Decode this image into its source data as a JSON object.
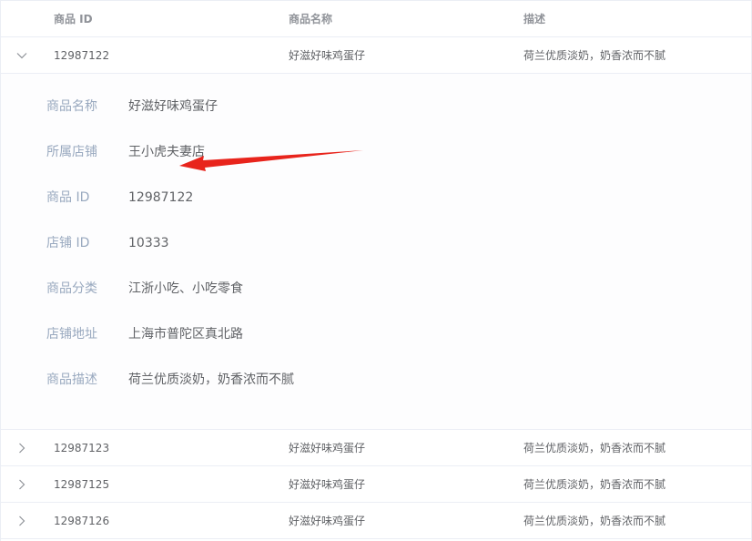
{
  "table": {
    "columns": [
      "商品 ID",
      "商品名称",
      "描述"
    ],
    "rows": [
      {
        "id": "12987122",
        "name": "好滋好味鸡蛋仔",
        "desc": "荷兰优质淡奶，奶香浓而不腻",
        "expanded": true
      },
      {
        "id": "12987123",
        "name": "好滋好味鸡蛋仔",
        "desc": "荷兰优质淡奶，奶香浓而不腻",
        "expanded": false
      },
      {
        "id": "12987125",
        "name": "好滋好味鸡蛋仔",
        "desc": "荷兰优质淡奶，奶香浓而不腻",
        "expanded": false
      },
      {
        "id": "12987126",
        "name": "好滋好味鸡蛋仔",
        "desc": "荷兰优质淡奶，奶香浓而不腻",
        "expanded": false
      }
    ]
  },
  "detail": {
    "items": [
      {
        "label": "商品名称",
        "value": "好滋好味鸡蛋仔"
      },
      {
        "label": "所属店铺",
        "value": "王小虎夫妻店"
      },
      {
        "label": "商品 ID",
        "value": "12987122"
      },
      {
        "label": "店铺 ID",
        "value": "10333"
      },
      {
        "label": "商品分类",
        "value": "江浙小吃、小吃零食"
      },
      {
        "label": "店铺地址",
        "value": "上海市普陀区真北路"
      },
      {
        "label": "商品描述",
        "value": "荷兰优质淡奶，奶香浓而不腻"
      }
    ]
  },
  "icons": {
    "expanded": "chevron-down-icon",
    "collapsed": "chevron-right-icon",
    "annotation": "red-arrow-annotation"
  },
  "colors": {
    "header_text": "#909399",
    "body_text": "#606266",
    "detail_label": "#99a9bf",
    "border": "#ebeef5",
    "annotation_arrow": "#e8241c"
  }
}
